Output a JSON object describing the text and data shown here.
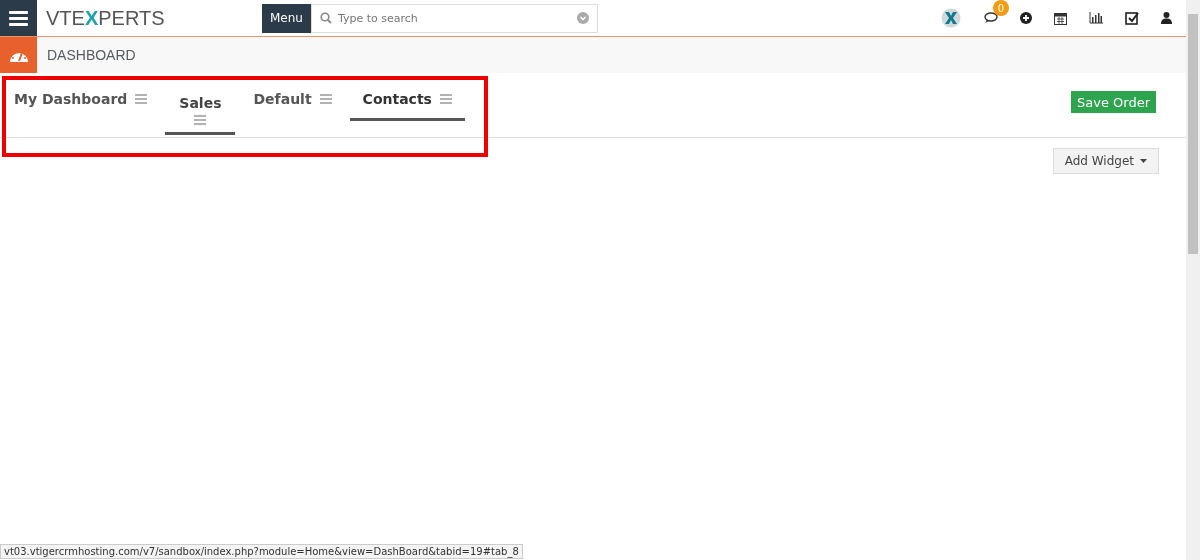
{
  "topbar": {
    "logo": {
      "before": "VTE",
      "mark": "X",
      "after": "PERTS"
    },
    "menu_button": "Menu",
    "search": {
      "placeholder": "Type to search"
    },
    "notification_count": "0"
  },
  "page": {
    "title": "DASHBOARD"
  },
  "tabs_highlighted": true,
  "tabs": [
    {
      "label": "My Dashboard",
      "selected": false,
      "dragging": false
    },
    {
      "label": "Sales",
      "selected": false,
      "dragging": true
    },
    {
      "label": "Default",
      "selected": false,
      "dragging": false
    },
    {
      "label": "Contacts",
      "selected": true,
      "dragging": false
    }
  ],
  "save_button": "Save Order",
  "add_widget_button": "Add Widget",
  "status_bar": "vt03.vtigercrmhosting.com/v7/sandbox/index.php?module=Home&view=DashBoard&tabid=19#tab_8"
}
